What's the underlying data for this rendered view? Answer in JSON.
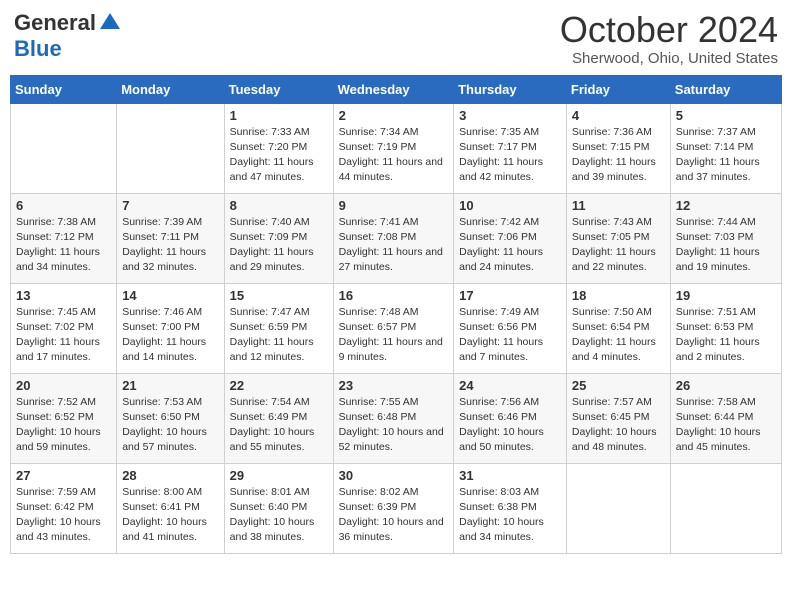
{
  "header": {
    "logo_general": "General",
    "logo_blue": "Blue",
    "month": "October 2024",
    "location": "Sherwood, Ohio, United States"
  },
  "days_of_week": [
    "Sunday",
    "Monday",
    "Tuesday",
    "Wednesday",
    "Thursday",
    "Friday",
    "Saturday"
  ],
  "weeks": [
    [
      {
        "day": "",
        "sunrise": "",
        "sunset": "",
        "daylight": ""
      },
      {
        "day": "",
        "sunrise": "",
        "sunset": "",
        "daylight": ""
      },
      {
        "day": "1",
        "sunrise": "Sunrise: 7:33 AM",
        "sunset": "Sunset: 7:20 PM",
        "daylight": "Daylight: 11 hours and 47 minutes."
      },
      {
        "day": "2",
        "sunrise": "Sunrise: 7:34 AM",
        "sunset": "Sunset: 7:19 PM",
        "daylight": "Daylight: 11 hours and 44 minutes."
      },
      {
        "day": "3",
        "sunrise": "Sunrise: 7:35 AM",
        "sunset": "Sunset: 7:17 PM",
        "daylight": "Daylight: 11 hours and 42 minutes."
      },
      {
        "day": "4",
        "sunrise": "Sunrise: 7:36 AM",
        "sunset": "Sunset: 7:15 PM",
        "daylight": "Daylight: 11 hours and 39 minutes."
      },
      {
        "day": "5",
        "sunrise": "Sunrise: 7:37 AM",
        "sunset": "Sunset: 7:14 PM",
        "daylight": "Daylight: 11 hours and 37 minutes."
      }
    ],
    [
      {
        "day": "6",
        "sunrise": "Sunrise: 7:38 AM",
        "sunset": "Sunset: 7:12 PM",
        "daylight": "Daylight: 11 hours and 34 minutes."
      },
      {
        "day": "7",
        "sunrise": "Sunrise: 7:39 AM",
        "sunset": "Sunset: 7:11 PM",
        "daylight": "Daylight: 11 hours and 32 minutes."
      },
      {
        "day": "8",
        "sunrise": "Sunrise: 7:40 AM",
        "sunset": "Sunset: 7:09 PM",
        "daylight": "Daylight: 11 hours and 29 minutes."
      },
      {
        "day": "9",
        "sunrise": "Sunrise: 7:41 AM",
        "sunset": "Sunset: 7:08 PM",
        "daylight": "Daylight: 11 hours and 27 minutes."
      },
      {
        "day": "10",
        "sunrise": "Sunrise: 7:42 AM",
        "sunset": "Sunset: 7:06 PM",
        "daylight": "Daylight: 11 hours and 24 minutes."
      },
      {
        "day": "11",
        "sunrise": "Sunrise: 7:43 AM",
        "sunset": "Sunset: 7:05 PM",
        "daylight": "Daylight: 11 hours and 22 minutes."
      },
      {
        "day": "12",
        "sunrise": "Sunrise: 7:44 AM",
        "sunset": "Sunset: 7:03 PM",
        "daylight": "Daylight: 11 hours and 19 minutes."
      }
    ],
    [
      {
        "day": "13",
        "sunrise": "Sunrise: 7:45 AM",
        "sunset": "Sunset: 7:02 PM",
        "daylight": "Daylight: 11 hours and 17 minutes."
      },
      {
        "day": "14",
        "sunrise": "Sunrise: 7:46 AM",
        "sunset": "Sunset: 7:00 PM",
        "daylight": "Daylight: 11 hours and 14 minutes."
      },
      {
        "day": "15",
        "sunrise": "Sunrise: 7:47 AM",
        "sunset": "Sunset: 6:59 PM",
        "daylight": "Daylight: 11 hours and 12 minutes."
      },
      {
        "day": "16",
        "sunrise": "Sunrise: 7:48 AM",
        "sunset": "Sunset: 6:57 PM",
        "daylight": "Daylight: 11 hours and 9 minutes."
      },
      {
        "day": "17",
        "sunrise": "Sunrise: 7:49 AM",
        "sunset": "Sunset: 6:56 PM",
        "daylight": "Daylight: 11 hours and 7 minutes."
      },
      {
        "day": "18",
        "sunrise": "Sunrise: 7:50 AM",
        "sunset": "Sunset: 6:54 PM",
        "daylight": "Daylight: 11 hours and 4 minutes."
      },
      {
        "day": "19",
        "sunrise": "Sunrise: 7:51 AM",
        "sunset": "Sunset: 6:53 PM",
        "daylight": "Daylight: 11 hours and 2 minutes."
      }
    ],
    [
      {
        "day": "20",
        "sunrise": "Sunrise: 7:52 AM",
        "sunset": "Sunset: 6:52 PM",
        "daylight": "Daylight: 10 hours and 59 minutes."
      },
      {
        "day": "21",
        "sunrise": "Sunrise: 7:53 AM",
        "sunset": "Sunset: 6:50 PM",
        "daylight": "Daylight: 10 hours and 57 minutes."
      },
      {
        "day": "22",
        "sunrise": "Sunrise: 7:54 AM",
        "sunset": "Sunset: 6:49 PM",
        "daylight": "Daylight: 10 hours and 55 minutes."
      },
      {
        "day": "23",
        "sunrise": "Sunrise: 7:55 AM",
        "sunset": "Sunset: 6:48 PM",
        "daylight": "Daylight: 10 hours and 52 minutes."
      },
      {
        "day": "24",
        "sunrise": "Sunrise: 7:56 AM",
        "sunset": "Sunset: 6:46 PM",
        "daylight": "Daylight: 10 hours and 50 minutes."
      },
      {
        "day": "25",
        "sunrise": "Sunrise: 7:57 AM",
        "sunset": "Sunset: 6:45 PM",
        "daylight": "Daylight: 10 hours and 48 minutes."
      },
      {
        "day": "26",
        "sunrise": "Sunrise: 7:58 AM",
        "sunset": "Sunset: 6:44 PM",
        "daylight": "Daylight: 10 hours and 45 minutes."
      }
    ],
    [
      {
        "day": "27",
        "sunrise": "Sunrise: 7:59 AM",
        "sunset": "Sunset: 6:42 PM",
        "daylight": "Daylight: 10 hours and 43 minutes."
      },
      {
        "day": "28",
        "sunrise": "Sunrise: 8:00 AM",
        "sunset": "Sunset: 6:41 PM",
        "daylight": "Daylight: 10 hours and 41 minutes."
      },
      {
        "day": "29",
        "sunrise": "Sunrise: 8:01 AM",
        "sunset": "Sunset: 6:40 PM",
        "daylight": "Daylight: 10 hours and 38 minutes."
      },
      {
        "day": "30",
        "sunrise": "Sunrise: 8:02 AM",
        "sunset": "Sunset: 6:39 PM",
        "daylight": "Daylight: 10 hours and 36 minutes."
      },
      {
        "day": "31",
        "sunrise": "Sunrise: 8:03 AM",
        "sunset": "Sunset: 6:38 PM",
        "daylight": "Daylight: 10 hours and 34 minutes."
      },
      {
        "day": "",
        "sunrise": "",
        "sunset": "",
        "daylight": ""
      },
      {
        "day": "",
        "sunrise": "",
        "sunset": "",
        "daylight": ""
      }
    ]
  ]
}
